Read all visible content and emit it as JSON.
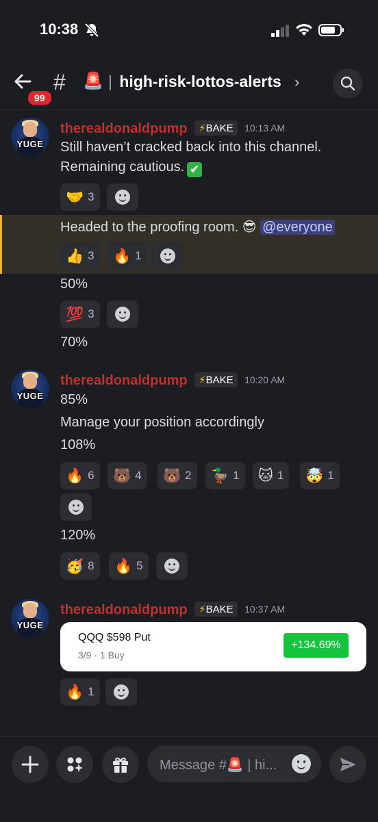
{
  "status_bar": {
    "time": "10:38"
  },
  "header": {
    "back_badge": "99",
    "channel_emoji": "🚨",
    "separator": "|",
    "channel_name": "high-risk-lottos-alerts",
    "chevron": "›"
  },
  "messages": [
    {
      "author": "therealdonaldpump",
      "avatar_text": "YUGE",
      "role": "BAKE",
      "timestamp": "10:13 AM",
      "lines": [
        "Still haven’t cracked back into this channel.",
        "Remaining cautious."
      ],
      "reactions_1": [
        {
          "emoji": "🤝",
          "count": "3"
        }
      ],
      "highlighted_text": "Headed to the proofing room.",
      "highlighted_emoji": "😎",
      "mention": "@everyone",
      "reactions_2": [
        {
          "emoji": "👍",
          "count": "3"
        },
        {
          "emoji": "🔥",
          "count": "1"
        }
      ],
      "line_50": "50%",
      "reactions_3": [
        {
          "emoji": "💯",
          "count": "3"
        }
      ],
      "line_70": "70%"
    },
    {
      "author": "therealdonaldpump",
      "avatar_text": "YUGE",
      "role": "BAKE",
      "timestamp": "10:20 AM",
      "line_85": "85%",
      "line_manage": "Manage your position accordingly",
      "line_108": "108%",
      "reactions_1": [
        {
          "emoji": "🔥",
          "count": "6"
        },
        {
          "emoji": "🐻",
          "count": "4"
        },
        {
          "emoji": "🐻",
          "count": "2"
        },
        {
          "emoji": "🦆",
          "count": "1"
        },
        {
          "emoji": "🐱",
          "count": "1"
        },
        {
          "emoji": "🤯",
          "count": "1"
        }
      ],
      "line_120": "120%",
      "reactions_2": [
        {
          "emoji": "🥳",
          "count": "8"
        },
        {
          "emoji": "🔥",
          "count": "5"
        }
      ]
    },
    {
      "author": "therealdonaldpump",
      "avatar_text": "YUGE",
      "role": "BAKE",
      "timestamp": "10:37 AM",
      "card": {
        "title": "QQQ $598 Put",
        "subtitle": "3/9 · 1 Buy",
        "change": "+134.69%"
      },
      "reactions_1": [
        {
          "emoji": "🔥",
          "count": "1"
        }
      ]
    }
  ],
  "composer": {
    "placeholder": "Message #🚨 | hi..."
  },
  "colors": {
    "username": "#c0312b",
    "highlight_bar": "#f0b232",
    "gain": "#14c43e",
    "background": "#1c1d22"
  }
}
